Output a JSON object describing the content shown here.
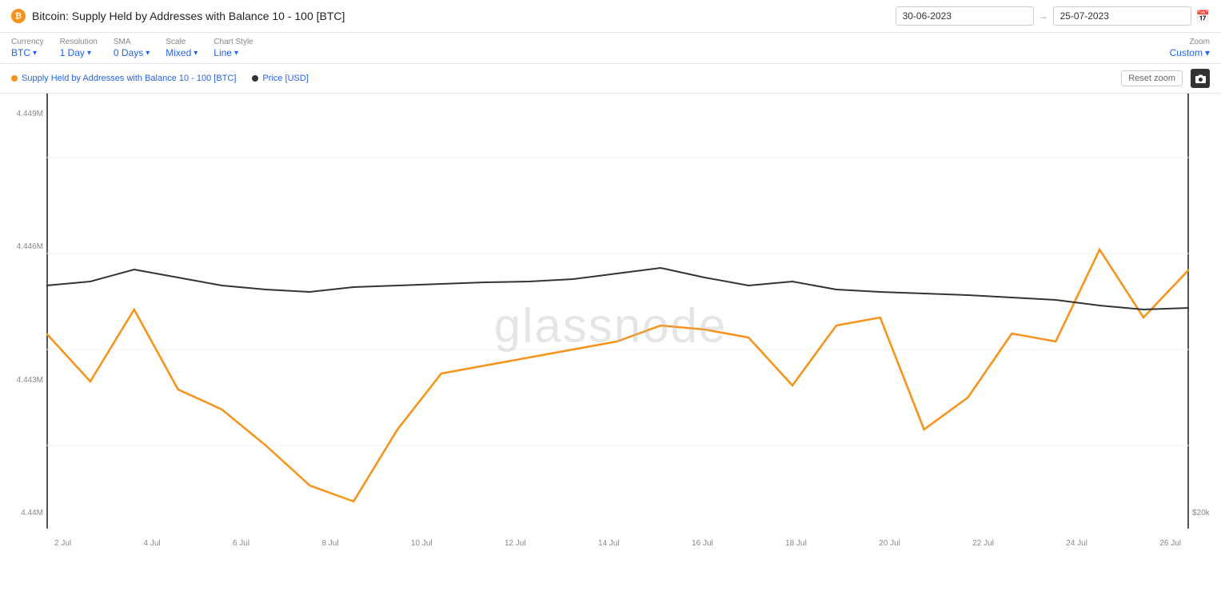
{
  "header": {
    "icon_label": "₿",
    "title": "Bitcoin: Supply Held by Addresses with Balance 10 - 100 [BTC]",
    "date_start": "30-06-2023",
    "date_end": "25-07-2023",
    "calendar_icon": "📅"
  },
  "controls": {
    "currency": {
      "label": "Currency",
      "value": "BTC"
    },
    "resolution": {
      "label": "Resolution",
      "value": "1 Day"
    },
    "sma": {
      "label": "SMA",
      "value": "0 Days"
    },
    "scale": {
      "label": "Scale",
      "value": "Mixed"
    },
    "chart_style": {
      "label": "Chart Style",
      "value": "Line"
    },
    "zoom": {
      "label": "Zoom",
      "value": "Custom"
    }
  },
  "legend": {
    "items": [
      {
        "label": "Supply Held by Addresses with Balance 10 - 100 [BTC]",
        "color": "#f7931a"
      },
      {
        "label": "Price [USD]",
        "color": "#333"
      }
    ],
    "reset_zoom": "Reset zoom",
    "camera_icon": "📷"
  },
  "chart": {
    "watermark": "glassnode",
    "y_labels": [
      "4.449M",
      "4.446M",
      "4.443M",
      "4.44M"
    ],
    "y_right_label": "$20k",
    "x_labels": [
      "2 Jul",
      "4 Jul",
      "6 Jul",
      "8 Jul",
      "10 Jul",
      "12 Jul",
      "14 Jul",
      "16 Jul",
      "18 Jul",
      "20 Jul",
      "22 Jul",
      "24 Jul",
      "26 Jul"
    ]
  }
}
